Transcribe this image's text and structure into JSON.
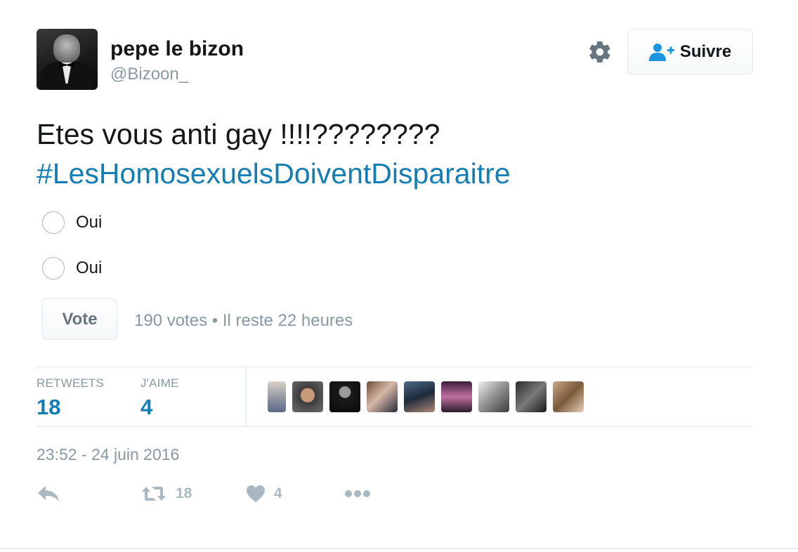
{
  "author": {
    "name": "pepe le bizon",
    "handle": "@Bizoon_"
  },
  "follow_button": {
    "label": "Suivre",
    "icon": "follow-user-plus-icon"
  },
  "settings_icon": "gear-icon",
  "tweet": {
    "text": "Etes vous anti gay !!!!????????",
    "hashtag": "#LesHomosexuelsDoiventDisparaitre"
  },
  "poll": {
    "choices": [
      {
        "label": "Oui"
      },
      {
        "label": "Oui"
      }
    ],
    "vote_label": "Vote",
    "meta": "190 votes • Il reste 22 heures"
  },
  "stats": {
    "retweets": {
      "label": "RETWEETS",
      "value": "18"
    },
    "likes": {
      "label": "J'AIME",
      "value": "4"
    }
  },
  "likers_count": 9,
  "timestamp": "23:52 - 24 juin 2016",
  "actions": {
    "reply": {
      "icon": "reply-icon"
    },
    "retweet": {
      "icon": "retweet-icon",
      "count": "18"
    },
    "like": {
      "icon": "heart-icon",
      "count": "4"
    },
    "more": {
      "icon": "more-dots-icon"
    }
  },
  "colors": {
    "link": "#137eb3",
    "muted": "#8899a6",
    "icon": "#aab8c2"
  }
}
